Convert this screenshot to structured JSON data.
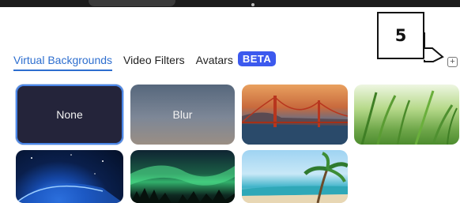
{
  "annotation": {
    "callout_number": "5"
  },
  "tabs": [
    {
      "label": "Virtual Backgrounds",
      "active": true
    },
    {
      "label": "Video Filters",
      "active": false
    },
    {
      "label": "Avatars",
      "active": false
    }
  ],
  "beta_badge": "BETA",
  "add_button": {
    "symbol": "+",
    "icon": "add-icon"
  },
  "backgrounds": {
    "none_label": "None",
    "blur_label": "Blur"
  },
  "colors": {
    "accent": "#2d6ecf",
    "beta_badge": "#3c59ee",
    "selected_border": "#4a86e8"
  }
}
